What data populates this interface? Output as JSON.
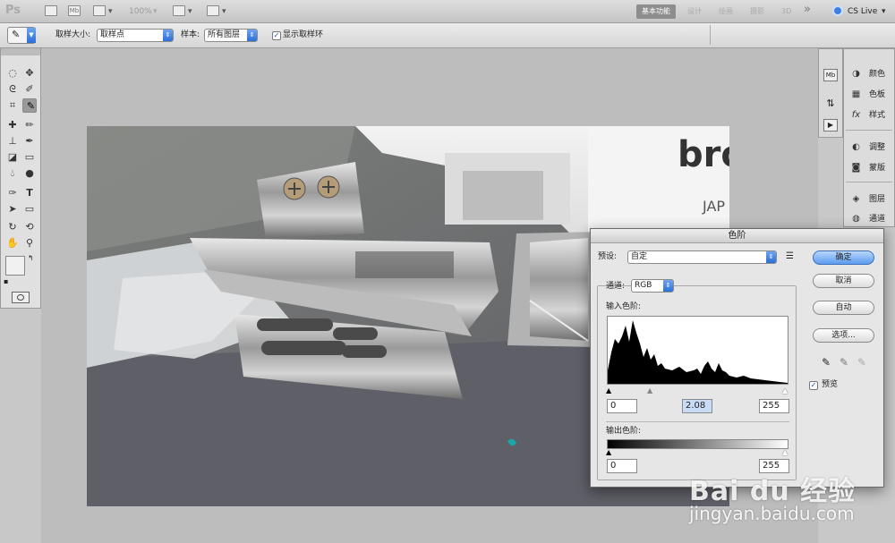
{
  "appbar": {
    "logo": "Ps",
    "zoom": "100%",
    "workspaces": [
      "基本功能",
      "设计",
      "绘画",
      "摄影",
      "3D"
    ],
    "active_workspace": "基本功能",
    "more": "»",
    "cslive": "CS Live"
  },
  "options": {
    "sample_size_label": "取样大小:",
    "sample_size_value": "取样点",
    "sample_label": "样本:",
    "sample_value": "所有图层",
    "show_ring_label": "显示取样环",
    "show_ring_checked": true
  },
  "right_panels": {
    "items": [
      {
        "label": "颜色",
        "icon": "color-icon"
      },
      {
        "label": "色板",
        "icon": "swatches-icon"
      },
      {
        "label": "样式",
        "icon": "styles-icon"
      },
      {
        "label": "调整",
        "icon": "adjustments-icon"
      },
      {
        "label": "蒙版",
        "icon": "masks-icon"
      },
      {
        "label": "图层",
        "icon": "layers-icon"
      },
      {
        "label": "通道",
        "icon": "channels-icon"
      }
    ]
  },
  "dialog": {
    "title": "色阶",
    "preset_label": "预设:",
    "preset_value": "自定",
    "channel_label": "通道:",
    "channel_value": "RGB",
    "input_levels_label": "输入色阶:",
    "input_black": "0",
    "input_gamma": "2.08",
    "input_white": "255",
    "output_levels_label": "输出色阶:",
    "output_black": "0",
    "output_white": "255",
    "buttons": {
      "ok": "确定",
      "cancel": "取消",
      "auto": "自动",
      "options": "选项..."
    },
    "preview_label": "预览",
    "preview_checked": true
  },
  "watermark": {
    "brand": "Bai du 经验",
    "url": "jingyan.baidu.com"
  },
  "photo": {
    "printer_text": "bro",
    "printer_subtext": "JAP"
  },
  "colors": {
    "accent": "#3f7fe0",
    "dialog_bg": "#e6e6e6",
    "panel_bg": "#dcdcdc"
  }
}
